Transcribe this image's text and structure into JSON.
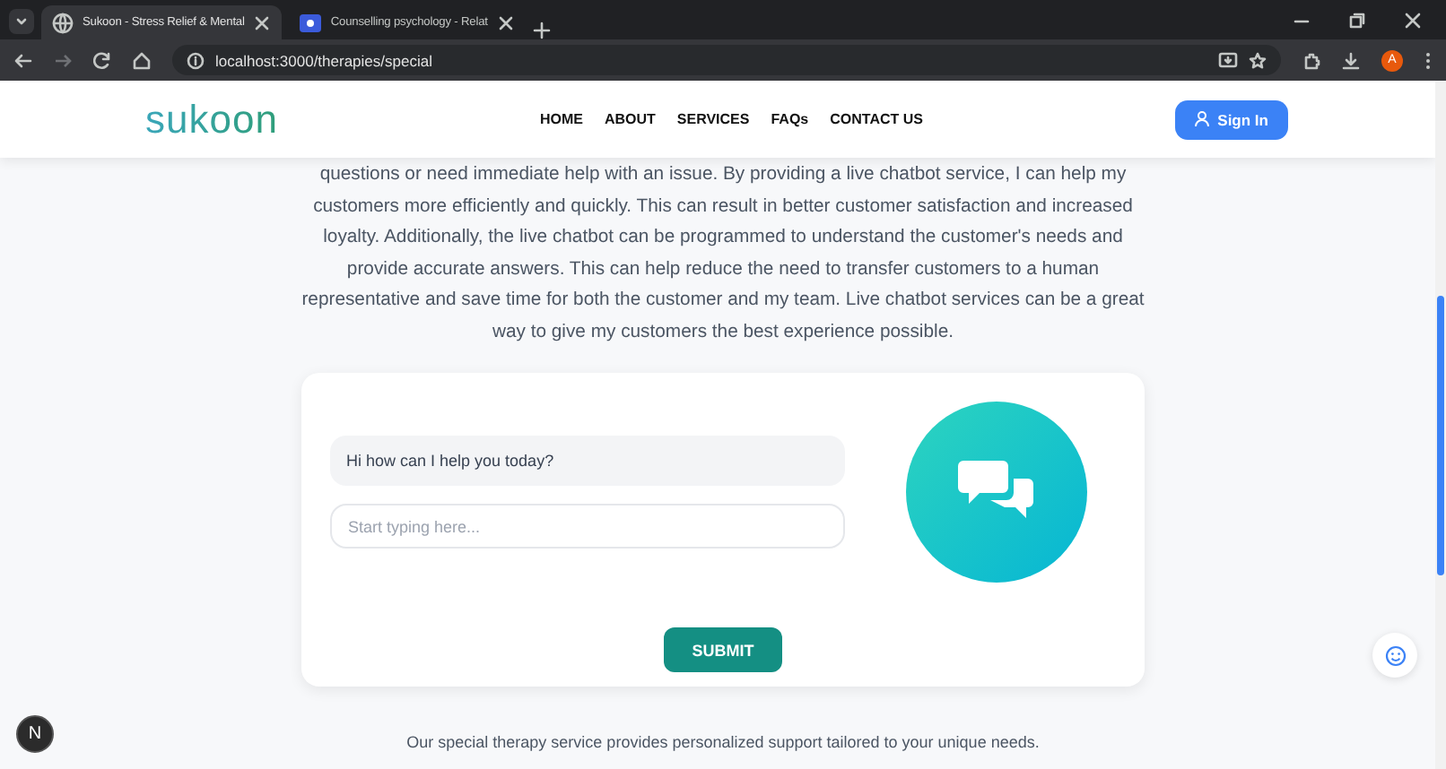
{
  "browser": {
    "tabs": [
      {
        "title": "Sukoon - Stress Relief & Mental",
        "selected": true
      },
      {
        "title": "Counselling psychology - Relat",
        "selected": false
      }
    ],
    "address": "localhost:3000/therapies/special",
    "profile_initial": "A"
  },
  "header": {
    "logo": "sukoon",
    "nav": [
      "HOME",
      "ABOUT",
      "SERVICES",
      "FAQs",
      "CONTACT US"
    ],
    "sign_in": "Sign In"
  },
  "intro": "questions or need immediate help with an issue. By providing a live chatbot service, I can help my customers more efficiently and quickly. This can result in better customer satisfaction and increased loyalty. Additionally, the live chatbot can be programmed to understand the customer's needs and provide accurate answers. This can help reduce the need to transfer customers to a human representative and save time for both the customer and my team. Live chatbot services can be a great way to give my customers the best experience possible.",
  "chat": {
    "messages": [
      "Hi how can I help you today?"
    ],
    "input": {
      "placeholder": "Start typing here..."
    },
    "submit": "SUBMIT"
  },
  "footer_text": "Our special therapy service provides personalized support tailored to your unique needs.",
  "dev_badge": "N"
}
